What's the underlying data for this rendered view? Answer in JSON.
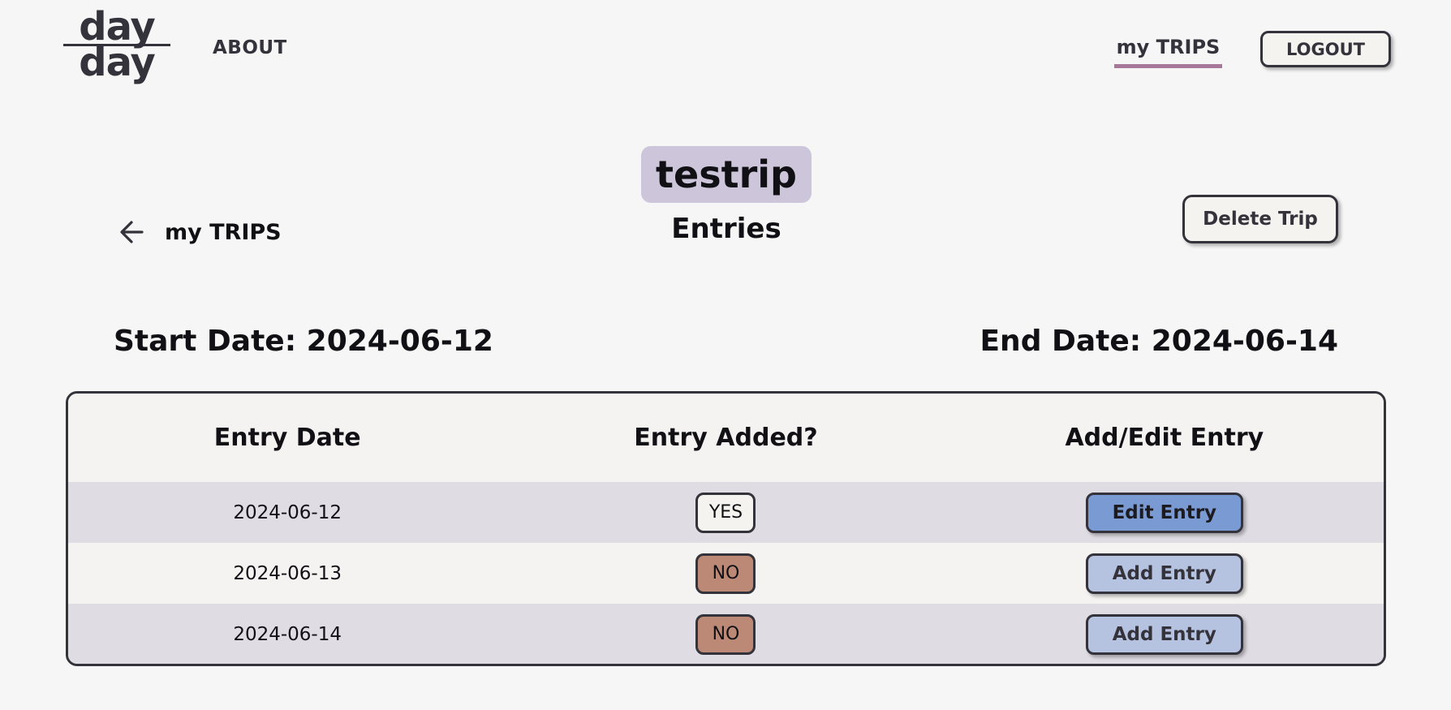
{
  "header": {
    "logo_line1": "day",
    "logo_line2": "day",
    "nav_about": "ABOUT",
    "nav_my_trips": "my TRIPS",
    "logout_label": "LOGOUT"
  },
  "trip": {
    "name": "testrip",
    "section_heading": "Entries",
    "back_label": "my TRIPS",
    "delete_label": "Delete Trip",
    "start_date_text": "Start Date: 2024-06-12",
    "end_date_text": "End Date: 2024-06-14"
  },
  "table": {
    "headers": [
      "Entry Date",
      "Entry Added?",
      "Add/Edit Entry"
    ],
    "rows": [
      {
        "date": "2024-06-12",
        "added": "YES",
        "action": "Edit Entry"
      },
      {
        "date": "2024-06-13",
        "added": "NO",
        "action": "Add Entry"
      },
      {
        "date": "2024-06-14",
        "added": "NO",
        "action": "Add Entry"
      }
    ]
  },
  "colors": {
    "background": "#f6f6f6",
    "title_badge": "#cdc5d9",
    "nav_underline": "#a8789a",
    "yes_badge": "#f5f3ef",
    "no_badge": "#bd8977",
    "edit_button": "#7a9ad4",
    "add_button": "#b5c3e0",
    "row_shaded": "#dfdce3"
  },
  "icons": {
    "back": "arrow-left-icon"
  }
}
